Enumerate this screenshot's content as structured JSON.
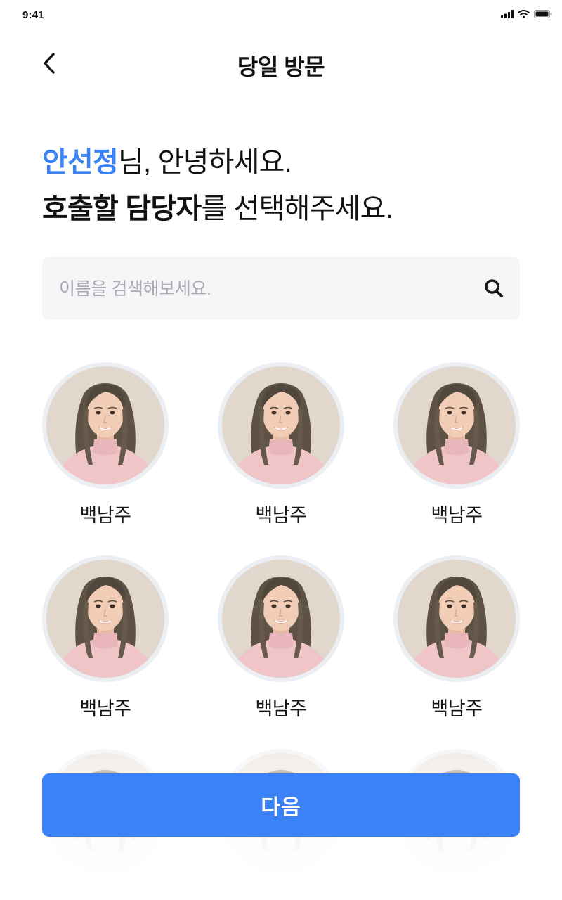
{
  "status_bar": {
    "time": "9:41",
    "icons": [
      "signal-icon",
      "wifi-icon",
      "battery-icon"
    ]
  },
  "header": {
    "title": "당일 방문",
    "back_icon": "chevron-left-icon"
  },
  "greeting": {
    "user_name": "안선정",
    "line1_suffix": "님, 안녕하세요.",
    "line2_bold": "호출할 담당자",
    "line2_suffix": "를 선택해주세요."
  },
  "search": {
    "placeholder": "이름을 검색해보세요.",
    "value": "",
    "icon": "search-icon"
  },
  "staff": [
    {
      "name": "백남주"
    },
    {
      "name": "백남주"
    },
    {
      "name": "백남주"
    },
    {
      "name": "백남주"
    },
    {
      "name": "백남주"
    },
    {
      "name": "백남주"
    },
    {
      "name": ""
    },
    {
      "name": ""
    },
    {
      "name": ""
    }
  ],
  "actions": {
    "next_label": "다음"
  },
  "colors": {
    "accent": "#3b82f6",
    "search_bg": "#f5f6f8",
    "avatar_ring": "#ebeef2",
    "photo_bg": "#e2d7cc",
    "hair": "#5e5245",
    "skin": "#f1cdb6",
    "sweater": "#efc5c8"
  }
}
